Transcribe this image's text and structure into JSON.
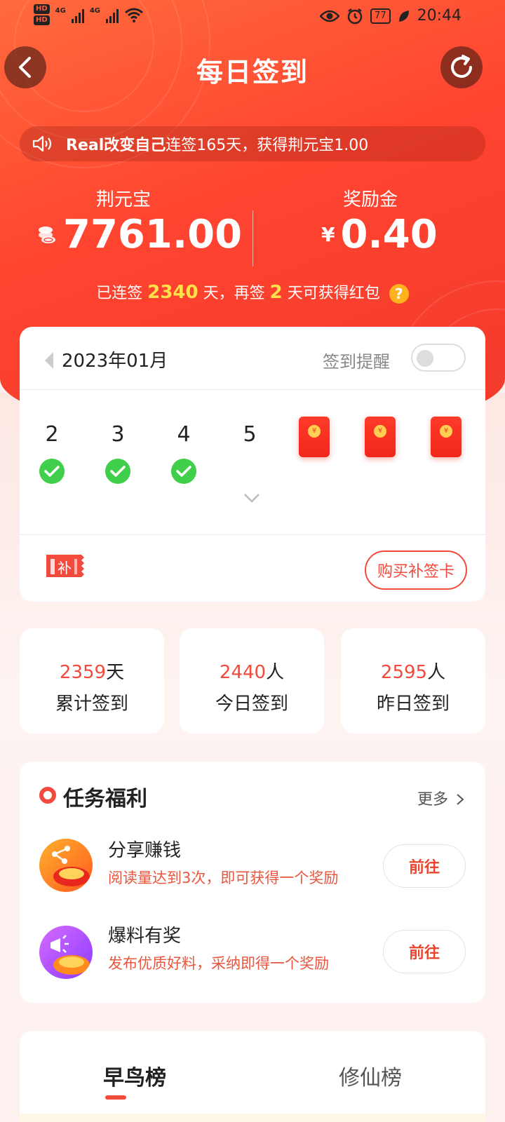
{
  "status_bar": {
    "hd1": "HD",
    "hd2": "HD",
    "net1": "4G",
    "net2": "4G",
    "battery": "77",
    "time": "20:44"
  },
  "header": {
    "title": "每日签到"
  },
  "notice": {
    "user": "Real改变自己",
    "text": "连签165天，获得荆元宝1.00"
  },
  "balances": {
    "coin_label": "荆元宝",
    "coin_value": "7761.00",
    "bonus_label": "奖励金",
    "bonus_currency": "¥",
    "bonus_value": "0.40"
  },
  "streak": {
    "prefix": "已连签",
    "days": "2340",
    "mid": "天，再签",
    "remaining": "2",
    "suffix": "天可获得红包",
    "help": "?"
  },
  "calendar": {
    "month": "2023年01月",
    "reminder_label": "签到提醒",
    "reminder_on": false,
    "days": [
      {
        "label": "2",
        "checked": true
      },
      {
        "label": "3",
        "checked": true
      },
      {
        "label": "4",
        "checked": true
      },
      {
        "label": "5",
        "checked": false
      }
    ],
    "red_packets": 3,
    "makeup_icon_text": "补",
    "buy_card_label": "购买补签卡"
  },
  "stats": [
    {
      "num": "2359",
      "unit": "天",
      "label": "累计签到"
    },
    {
      "num": "2440",
      "unit": "人",
      "label": "今日签到"
    },
    {
      "num": "2595",
      "unit": "人",
      "label": "昨日签到"
    }
  ],
  "tasks": {
    "title": "任务福利",
    "more": "更多",
    "items": [
      {
        "name": "分享赚钱",
        "desc": "阅读量达到3次，即可获得一个奖励",
        "action": "前往",
        "icon": "share-earn-icon"
      },
      {
        "name": "爆料有奖",
        "desc": "发布优质好料，采纳即得一个奖励",
        "action": "前往",
        "icon": "report-reward-icon"
      }
    ]
  },
  "ranks": {
    "tabs": [
      "早鸟榜",
      "修仙榜"
    ],
    "active": 0
  },
  "colors": {
    "primary": "#f24a3c",
    "accent_yellow": "#ffe24a",
    "check_green": "#3fcf4a"
  }
}
